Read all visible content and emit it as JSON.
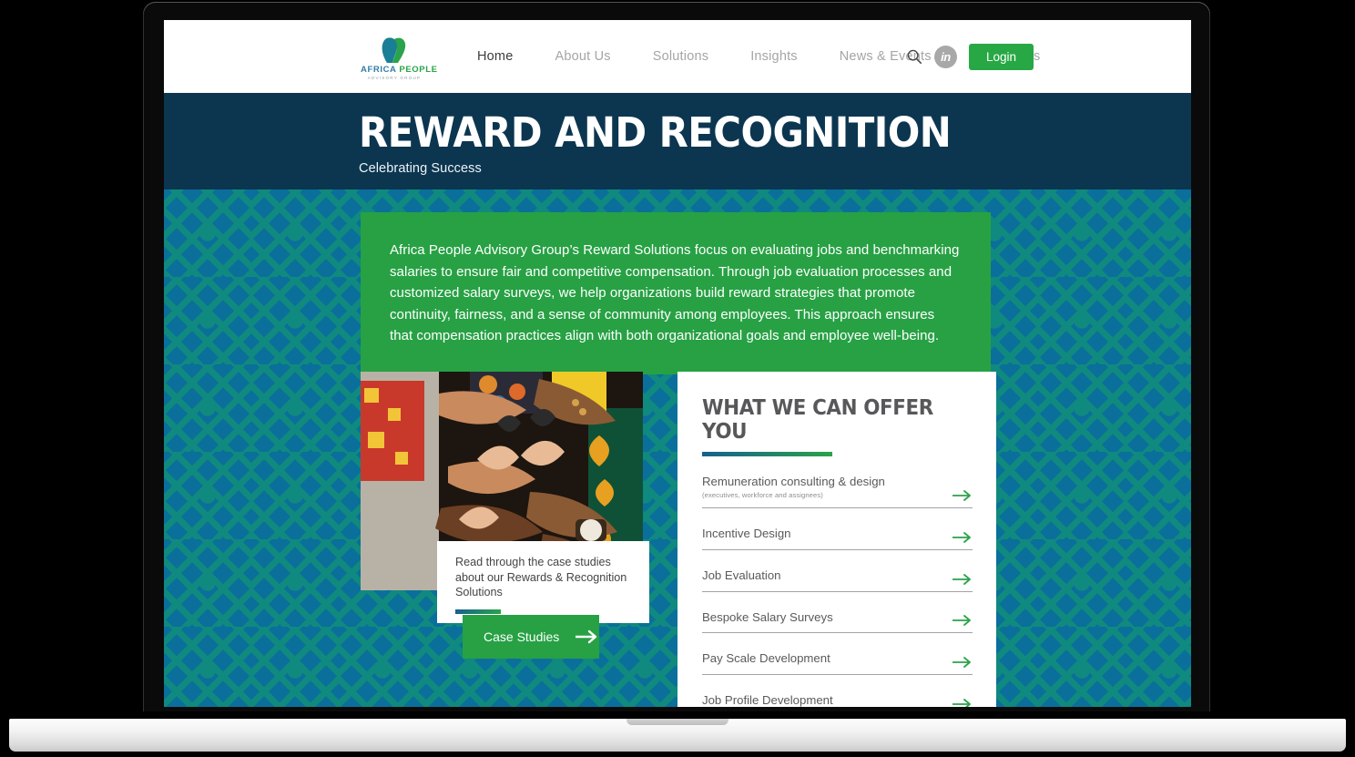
{
  "site": {
    "logo": {
      "name_primary": "AFRICA",
      "name_secondary": "PEOPLE",
      "tagline": "ADVISORY GROUP",
      "icon": "africa-map-icon"
    }
  },
  "nav": {
    "links": [
      {
        "label": "Home",
        "active": true
      },
      {
        "label": "About Us",
        "active": false
      },
      {
        "label": "Solutions",
        "active": false
      },
      {
        "label": "Insights",
        "active": false
      },
      {
        "label": "News & Events",
        "active": false
      },
      {
        "label": "Contact Us",
        "active": false
      }
    ],
    "search_icon": "search-icon",
    "linkedin_icon": "linkedin-icon",
    "linkedin_label": "in",
    "login_label": "Login"
  },
  "hero": {
    "title": "REWARD AND RECOGNITION",
    "subtitle": "Celebrating Success"
  },
  "intro": {
    "paragraph": "Africa People Advisory Group’s Reward Solutions focus on evaluating jobs and benchmarking salaries to ensure fair and competitive compensation. Through job evaluation processes and customized salary surveys, we help organizations build reward strategies that promote continuity, fairness, and a sense of community among employees. This approach ensures that compensation practices align with both organizational goals and employee well-being."
  },
  "photo": {
    "alt": "group of diverse hands forming heart shapes together",
    "name": "teamwork-hands-photo"
  },
  "case_study_card": {
    "text": "Read through the case studies about our Rewards & Recognition Solutions",
    "button_label": "Case Studies",
    "button_icon": "arrow-right-icon"
  },
  "offers": {
    "title": "WHAT WE CAN OFFER YOU",
    "items": [
      {
        "label": "Remuneration consulting & design",
        "note": "(executives, workforce and assignees)"
      },
      {
        "label": "Incentive Design",
        "note": ""
      },
      {
        "label": "Job Evaluation",
        "note": ""
      },
      {
        "label": "Bespoke Salary Surveys",
        "note": ""
      },
      {
        "label": "Pay Scale Development",
        "note": ""
      },
      {
        "label": "Job Profile Development",
        "note": ""
      }
    ],
    "arrow_icon": "arrow-right-icon"
  },
  "colors": {
    "navy": "#0c3650",
    "blue": "#0a6f9a",
    "teal": "#10897f",
    "green": "#27a144",
    "button_green": "#27a844"
  }
}
